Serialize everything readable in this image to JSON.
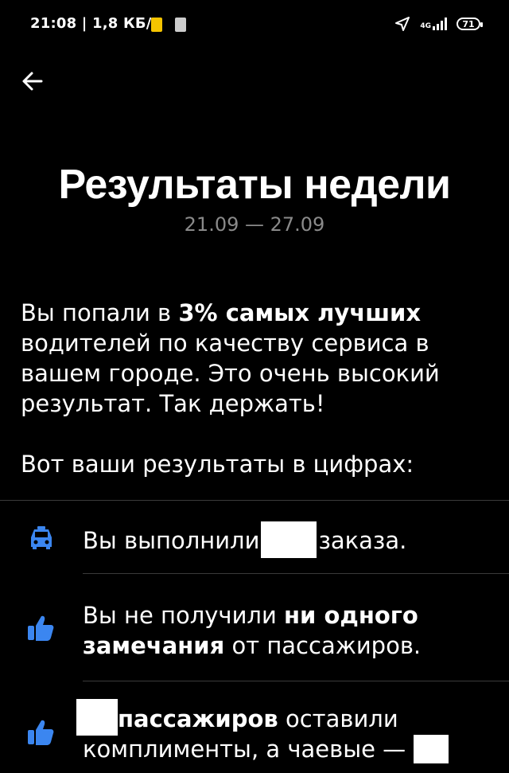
{
  "status_bar": {
    "time_speed": "21:08 | 1,8 КБ/с",
    "network": "4G",
    "battery": "71"
  },
  "header": {
    "title": "Результаты недели",
    "date_range": "21.09 — 27.09"
  },
  "intro": {
    "part1": "Вы попали в ",
    "highlight": "3% самых лучших",
    "part2": " водителей по качеству сервиса в вашем городе. Это очень высокий результат. Так держать!"
  },
  "results_heading": "Вот ваши результаты в цифрах:",
  "items": [
    {
      "icon": "taxi-car-icon",
      "before": "Вы выполнили",
      "after": "заказа."
    },
    {
      "icon": "thumbs-up-icon",
      "before": "Вы не получили ",
      "bold": "ни одного замечания",
      "after": " от пассажиров."
    },
    {
      "icon": "thumbs-up-icon",
      "bold": "пассажиров",
      "after": " оставили комплименты, а чаевые —"
    }
  ],
  "colors": {
    "background": "#000000",
    "text": "#ffffff",
    "muted": "#8a8a8a",
    "accent_blue": "#3b86f0"
  }
}
